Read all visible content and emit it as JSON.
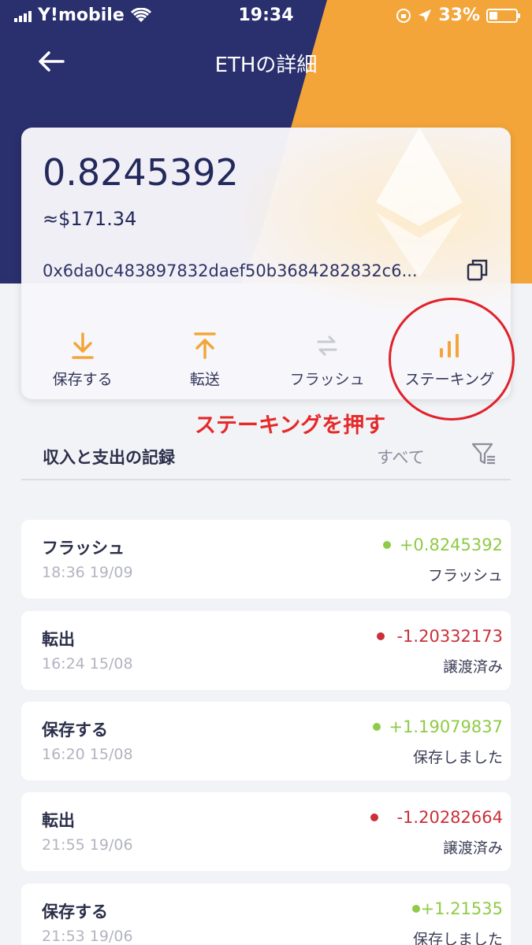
{
  "status_bar": {
    "carrier": "Y!mobile",
    "time": "19:34",
    "battery": "33%"
  },
  "header": {
    "title": "ETHの詳細"
  },
  "wallet": {
    "balance": "0.8245392",
    "fiat": "≈$171.34",
    "address": "0x6da0c483897832daef50b3684282832c6..."
  },
  "actions": [
    {
      "label": "保存する",
      "icon": "download-icon"
    },
    {
      "label": "転送",
      "icon": "upload-icon"
    },
    {
      "label": "フラッシュ",
      "icon": "swap-icon"
    },
    {
      "label": "ステーキング",
      "icon": "bar-chart-icon"
    }
  ],
  "annotation": "ステーキングを押す",
  "records": {
    "title": "収入と支出の記録",
    "filter_label": "すべて"
  },
  "transactions": [
    {
      "title": "フラッシュ",
      "time": "18:36 19/09",
      "amount": "+0.8245392",
      "status": "フラッシュ",
      "direction": "in"
    },
    {
      "title": "転出",
      "time": "16:24 15/08",
      "amount": "-1.20332173",
      "status": "譲渡済み",
      "direction": "out"
    },
    {
      "title": "保存する",
      "time": "16:20 15/08",
      "amount": "+1.19079837",
      "status": "保存しました",
      "direction": "in"
    },
    {
      "title": "転出",
      "time": "21:55 19/06",
      "amount": "-1.20282664",
      "status": "譲渡済み",
      "direction": "out"
    },
    {
      "title": "保存する",
      "time": "21:53 19/06",
      "amount": "+1.21535",
      "status": "保存しました",
      "direction": "in"
    }
  ],
  "colors": {
    "navy": "#2a2f6e",
    "orange": "#f3a53a",
    "positive": "#8fcb46",
    "negative": "#c9303a",
    "annotation": "#e52a2a"
  }
}
